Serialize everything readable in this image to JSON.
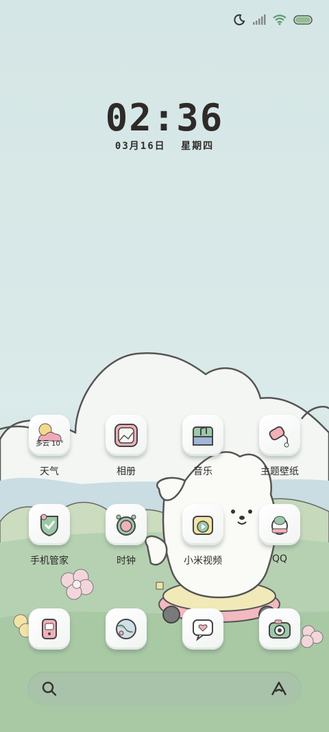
{
  "status_bar": {
    "icons": [
      "moon-icon",
      "signal-icon",
      "wifi-icon",
      "battery-icon"
    ]
  },
  "clock": {
    "time": "02:36",
    "date": "03月16日",
    "weekday": "星期四"
  },
  "apps": [
    {
      "label": "天气",
      "icon": "weather-icon",
      "weather_text": "多云 10°"
    },
    {
      "label": "相册",
      "icon": "gallery-icon"
    },
    {
      "label": "音乐",
      "icon": "music-icon"
    },
    {
      "label": "主题壁纸",
      "icon": "themes-icon"
    },
    {
      "label": "手机管家",
      "icon": "security-icon"
    },
    {
      "label": "时钟",
      "icon": "clock-icon"
    },
    {
      "label": "小米视频",
      "icon": "video-icon"
    },
    {
      "label": "QQ",
      "icon": "qq-icon"
    }
  ],
  "dock": [
    {
      "icon": "phone-icon"
    },
    {
      "icon": "browser-icon"
    },
    {
      "icon": "messages-icon"
    },
    {
      "icon": "camera-icon"
    }
  ],
  "search_bar": {
    "left_icon": "search-icon",
    "right_icon": "assistant-icon"
  },
  "colors": {
    "sky": "#d5e6e6",
    "grass": "#b7d2b7",
    "text": "#2f2a28"
  }
}
